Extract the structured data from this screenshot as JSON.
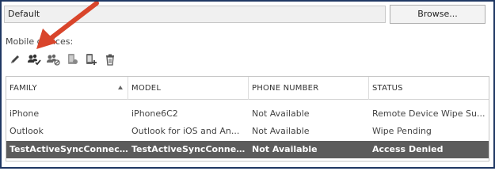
{
  "policy": {
    "value": "Default",
    "browse_label": "Browse..."
  },
  "mobile_devices": {
    "label": "Mobile devices:",
    "toolbar": [
      {
        "name": "edit-icon",
        "icon": "pencil"
      },
      {
        "name": "allow-device-icon",
        "icon": "users-check"
      },
      {
        "name": "block-device-icon",
        "icon": "users-block"
      },
      {
        "name": "wipe-device-icon",
        "icon": "phone-wipe"
      },
      {
        "name": "add-device-icon",
        "icon": "phone-add"
      },
      {
        "name": "delete-icon",
        "icon": "trash"
      }
    ]
  },
  "grid": {
    "columns": [
      "FAMILY",
      "MODEL",
      "PHONE NUMBER",
      "STATUS"
    ],
    "sorted_column": "FAMILY",
    "rows": [
      {
        "family": "iPhone",
        "model": "iPhone6C2",
        "phone": "Not Available",
        "status": "Remote Device Wipe Su..."
      },
      {
        "family": "Outlook",
        "model": "Outlook for iOS and An...",
        "phone": "Not Available",
        "status": "Wipe Pending"
      },
      {
        "family": "TestActiveSyncConnect...",
        "model": "TestActiveSyncConnect...",
        "phone": "Not Available",
        "status": "Access Denied"
      }
    ],
    "selected_row": 2
  },
  "colors": {
    "frame_border": "#1f3763",
    "selected_row_bg": "#5c5c5c",
    "annotation_arrow": "#d9452b"
  }
}
